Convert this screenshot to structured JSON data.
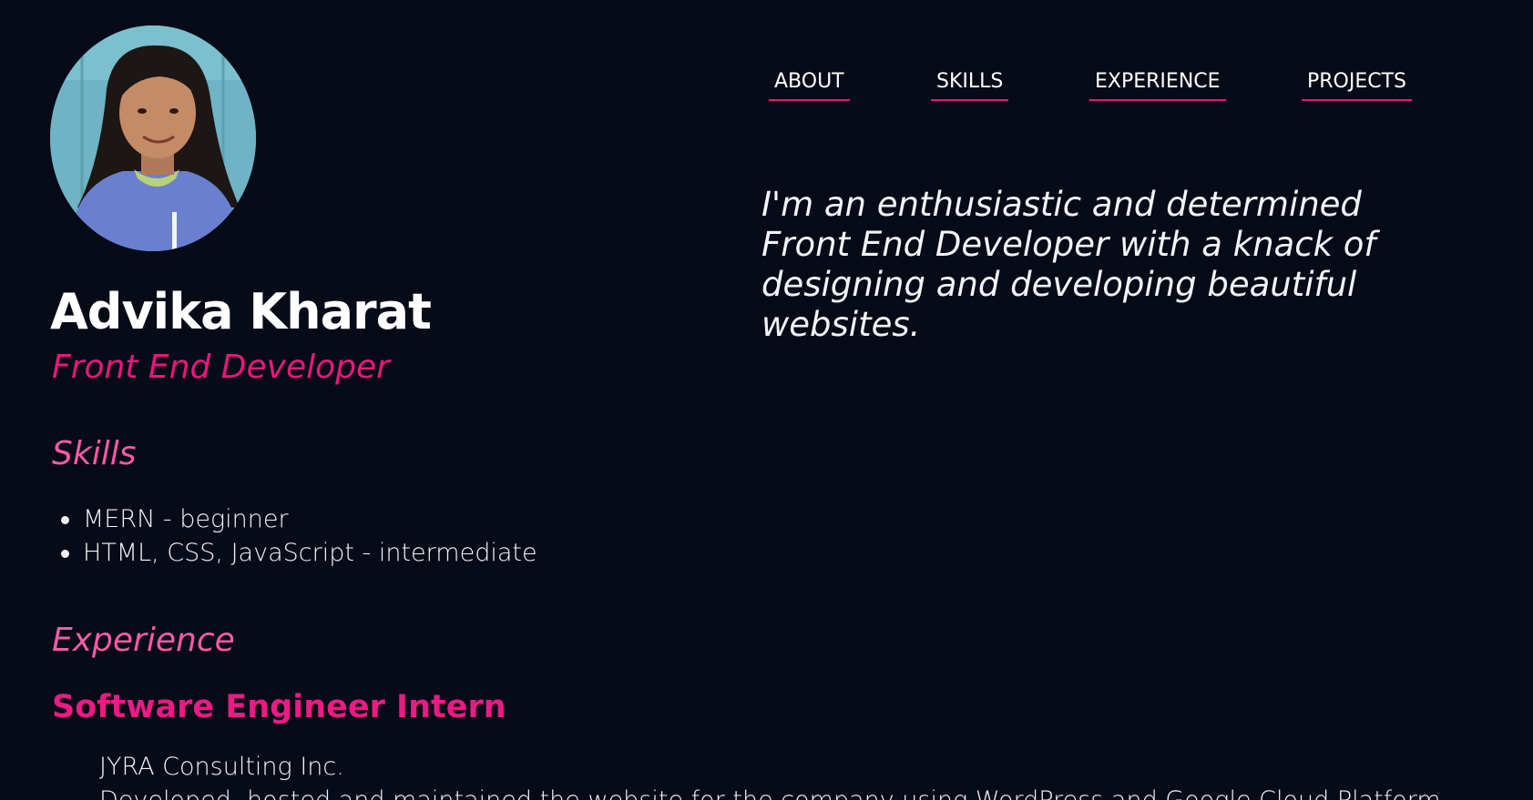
{
  "profile": {
    "name": "Advika Kharat",
    "role": "Front End Developer",
    "avatar_icon": "profile-photo"
  },
  "nav": {
    "items": [
      {
        "label": "ABOUT"
      },
      {
        "label": "SKILLS"
      },
      {
        "label": "EXPERIENCE"
      },
      {
        "label": "PROJECTS"
      }
    ]
  },
  "intro": {
    "text": "I'm an enthusiastic and determined Front End Developer with a knack of designing and developing beautiful websites."
  },
  "skills": {
    "heading": "Skills",
    "items": [
      "MERN - beginner",
      "HTML, CSS, JavaScript - intermediate"
    ]
  },
  "experience": {
    "heading": "Experience",
    "jobs": [
      {
        "title": "Software Engineer Intern",
        "company": "JYRA Consulting Inc.",
        "description": "Developed, hosted and maintained the website for the company using WordPress and Google Cloud Platform"
      }
    ]
  },
  "colors": {
    "background": "#070b17",
    "accent": "#e8187a",
    "heading_pink": "#f35ba6",
    "text": "#f2f4f8"
  }
}
